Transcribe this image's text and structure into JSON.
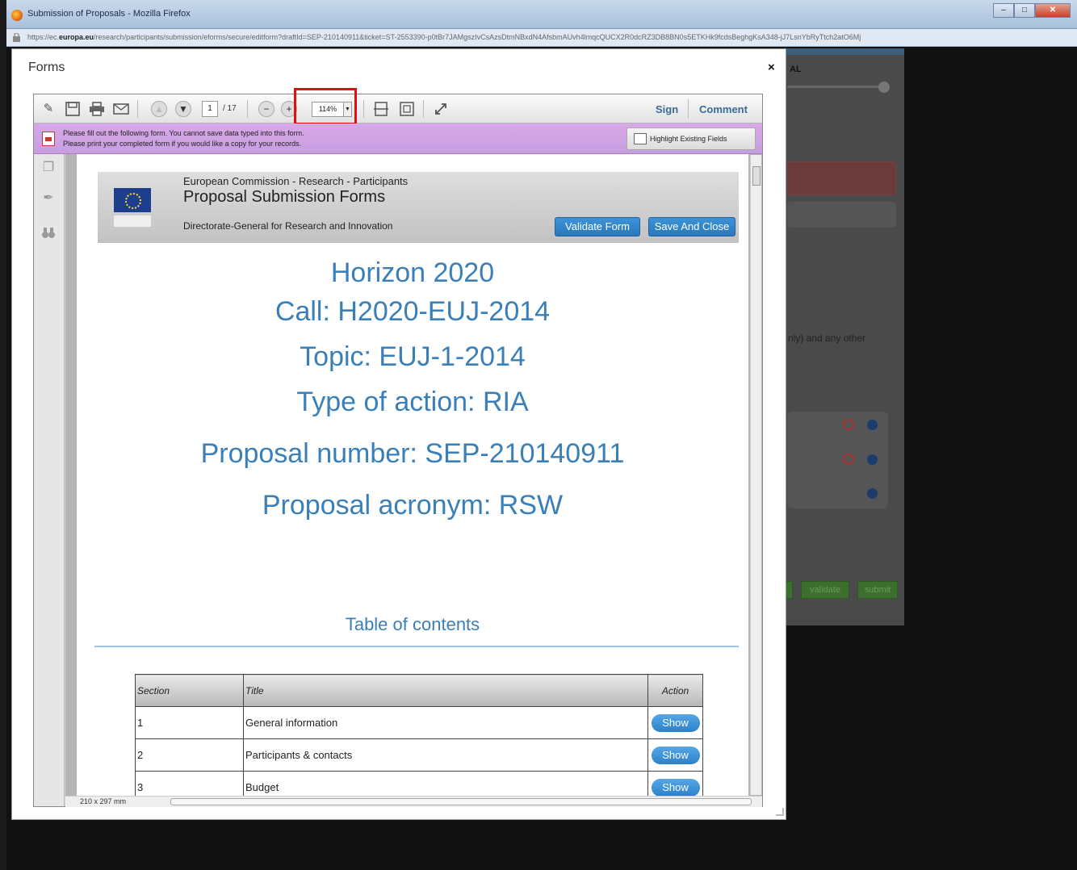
{
  "window": {
    "title": "Submission of Proposals - Mozilla Firefox",
    "controls": [
      "‒",
      "□",
      "✕"
    ]
  },
  "address_bar": {
    "scheme": "https://ec.",
    "domain": "europa.eu",
    "path": "/research/participants/submission/eforms/secure/editform?draftId=SEP-210140911&ticket=ST-2553390-p0tBr7JAMgszIvCsAzsDtmNBxdN4AfsbmAUvh4lmqcQUCX2R0dcRZ3DB8BN0s5ETKHk9fcdsBeghgKsA348-jJ7LsnYbRyTtch2atO6Mj"
  },
  "dialog": {
    "title": "Forms",
    "close": "×"
  },
  "pdf_toolbar": {
    "page_current": "1",
    "page_total": "/ 17",
    "zoom": "114%",
    "sign": "Sign",
    "comment": "Comment"
  },
  "notice": {
    "line1": "Please fill out the following form. You cannot save data typed into this form.",
    "line2": "Please print your completed form if you would like a copy for your records.",
    "highlight_button": "Highlight Existing Fields"
  },
  "doc_header": {
    "org_line": "European Commission - Research - Participants",
    "title": "Proposal Submission Forms",
    "dg": "Directorate-General for Research and Innovation",
    "validate_button": "Validate Form",
    "save_close_button": "Save And Close"
  },
  "doc_body": {
    "programme": "Horizon 2020",
    "call": "Call: H2020-EUJ-2014",
    "topic": "Topic: EUJ-1-2014",
    "action_type": "Type of action: RIA",
    "proposal_number": "Proposal number: SEP-210140911",
    "proposal_acronym": "Proposal acronym: RSW",
    "toc_title": "Table of contents"
  },
  "toc": {
    "headers": [
      "Section",
      "Title",
      "Action"
    ],
    "rows": [
      {
        "section": "1",
        "title": "General information",
        "action": "Show"
      },
      {
        "section": "2",
        "title": "Participants & contacts",
        "action": "Show"
      },
      {
        "section": "3",
        "title": "Budget",
        "action": "Show"
      }
    ]
  },
  "status": {
    "page_size": "210 x 297 mm"
  },
  "background_page": {
    "header_fragment": "AL",
    "text_fragment": "nly) and any other",
    "validate": "validate",
    "submit": "submit"
  },
  "colors": {
    "accent_blue": "#3a7fb8",
    "notice_purple": "#d0a3e4",
    "highlight_red": "#e01010"
  }
}
